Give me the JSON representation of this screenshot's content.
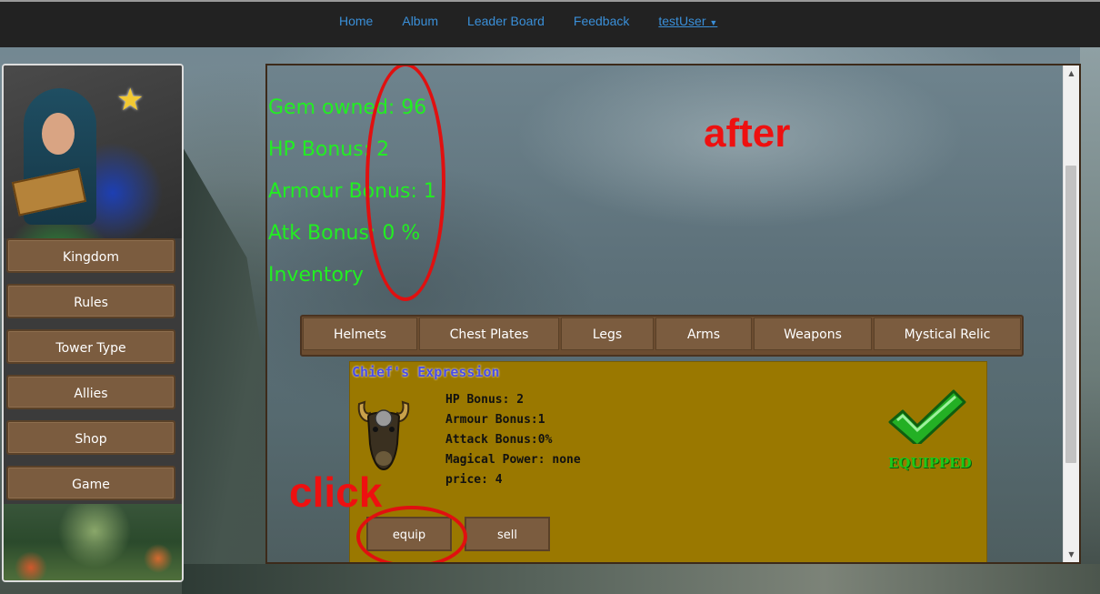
{
  "nav": {
    "items": [
      "Home",
      "Album",
      "Leader Board",
      "Feedback"
    ],
    "user": "testUser"
  },
  "sidebar": {
    "items": [
      "Kingdom",
      "Rules",
      "Tower Type",
      "Allies",
      "Shop",
      "Game"
    ]
  },
  "stats": {
    "gem": "Gem owned: 96",
    "hp": "HP Bonus: 2",
    "armour": "Armour Bonus: 1",
    "atk": "Atk Bonus: 0 %",
    "inventory": "Inventory"
  },
  "annotations": {
    "after": "after",
    "click": "click",
    "color": "#e01010"
  },
  "tabs": [
    "Helmets",
    "Chest Plates",
    "Legs",
    "Arms",
    "Weapons",
    "Mystical Relic"
  ],
  "item": {
    "name": "Chief's Expression",
    "hp": "HP Bonus: 2",
    "armour": "Armour Bonus:1",
    "attack": "Attack Bonus:0%",
    "magic": "Magical Power: none",
    "price": "price: 4",
    "status": "EQUIPPED",
    "equip_label": "equip",
    "sell_label": "sell",
    "icon": "bull-helmet-icon"
  },
  "colors": {
    "stat_text": "#22ee22",
    "button_bg": "#7b5c3f",
    "card_bg": "#9a7800"
  }
}
